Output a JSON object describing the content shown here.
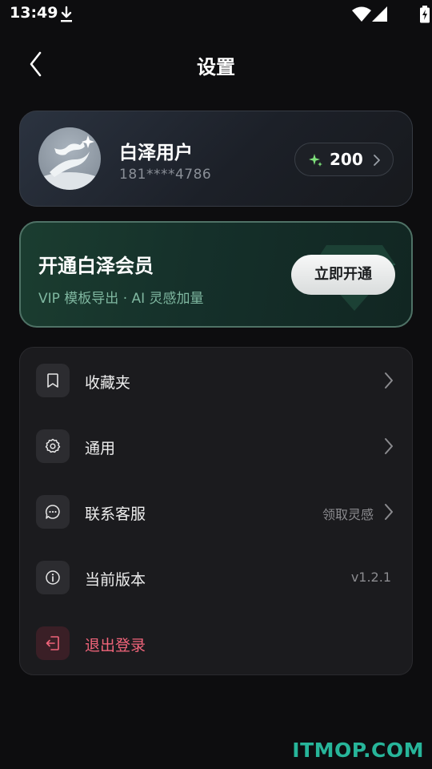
{
  "status_bar": {
    "time": "13:49"
  },
  "nav": {
    "title": "设置"
  },
  "profile": {
    "name": "白泽用户",
    "phone": "181****4786",
    "points": "200"
  },
  "vip": {
    "title": "开通白泽会员",
    "subtitle": "VIP 模板导出 · AI 灵感加量",
    "button_label": "立即开通"
  },
  "menu": [
    {
      "label": "收藏夹",
      "icon": "bookmark-icon",
      "extra": ""
    },
    {
      "label": "通用",
      "icon": "gear-icon",
      "extra": ""
    },
    {
      "label": "联系客服",
      "icon": "chat-icon",
      "extra": "领取灵感"
    },
    {
      "label": "当前版本",
      "icon": "info-icon",
      "extra": "v1.2.1"
    },
    {
      "label": "退出登录",
      "icon": "logout-icon",
      "extra": ""
    }
  ],
  "colors": {
    "accent_green": "#27b59a",
    "logout_red": "#f0647a",
    "points_spark": "#7ee07a"
  },
  "watermark": "ITMOP.COM"
}
